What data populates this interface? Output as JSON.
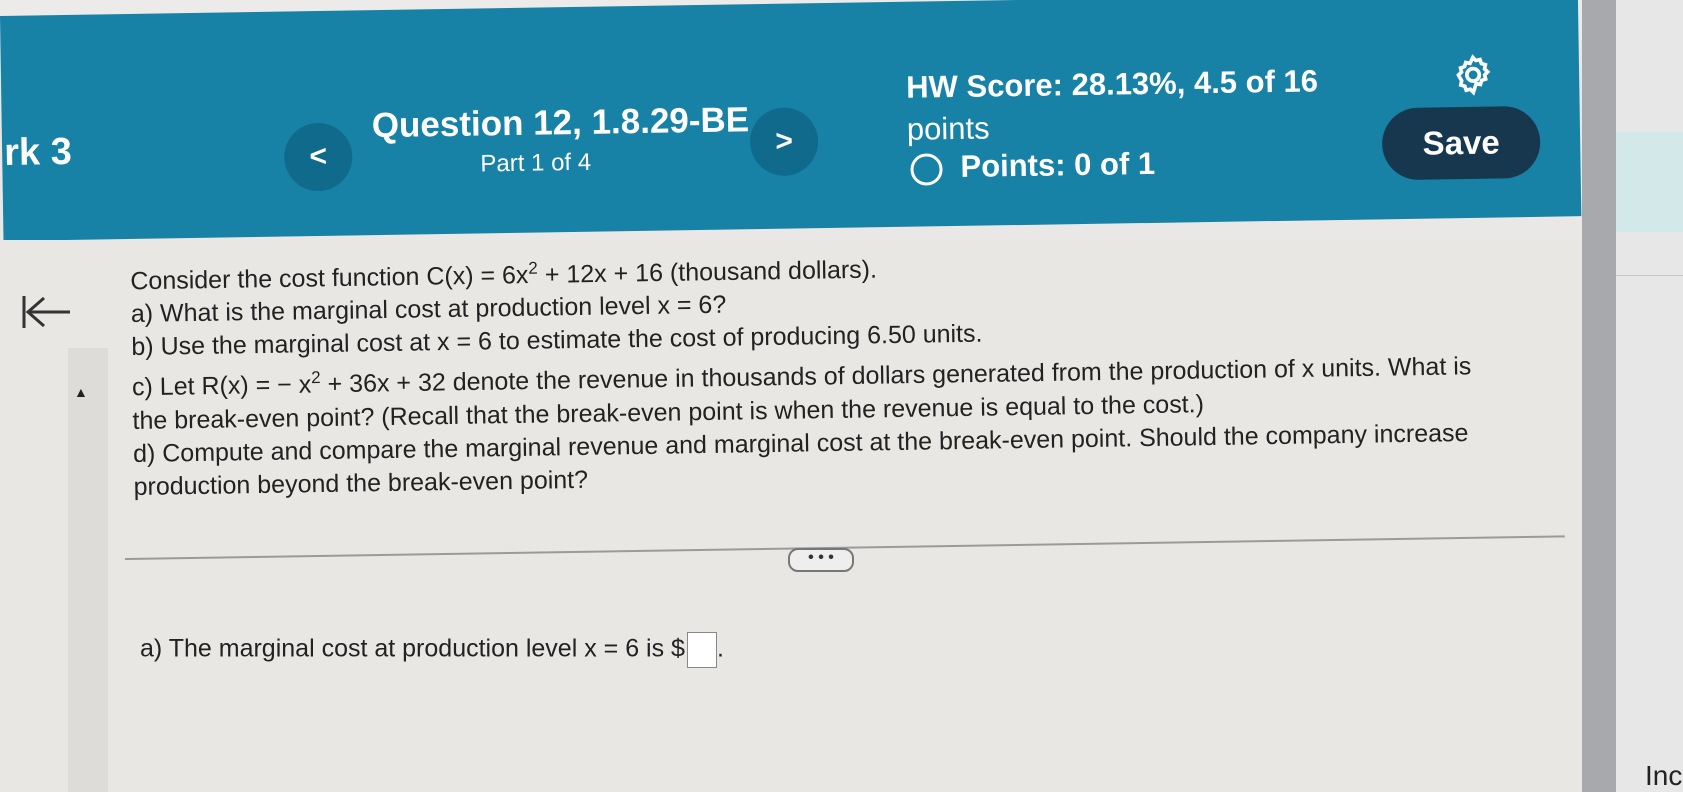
{
  "header": {
    "course_label": "rk 3",
    "prev_glyph": "<",
    "next_glyph": ">",
    "question_title": "Question 12, 1.8.29-BE",
    "question_part": "Part 1 of 4",
    "hw_score_line1": "HW Score: 28.13%, 4.5 of 16",
    "hw_score_line2": "points",
    "points_label": "Points: 0 of 1",
    "save_label": "Save",
    "settings_icon": "gear-icon"
  },
  "problem": {
    "intro_prefix": "Consider the cost function C(x) = 6x",
    "intro_exp": "2",
    "intro_suffix": " + 12x + 16 (thousand dollars).",
    "part_a": "a) What is the marginal cost at production level x = 6?",
    "part_b": "b) Use the marginal cost at x = 6 to estimate the cost of producing 6.50 units.",
    "part_c_prefix": "c) Let R(x) = − x",
    "part_c_exp": "2",
    "part_c_suffix": " + 36x + 32 denote the revenue in thousands of dollars generated from the production of x units. What is",
    "part_c_line2": "the break-even point? (Recall that the break-even point is when the revenue is equal to the cost.)",
    "part_d_line1": "d) Compute and compare the marginal revenue and marginal cost at the break-even point. Should the company increase",
    "part_d_line2": "production beyond the break-even point?"
  },
  "more_label": "• • •",
  "answer": {
    "prefix": "a) The marginal cost at production level x = 6 is $",
    "suffix": "."
  },
  "side": {
    "label": "Inc"
  },
  "colors": {
    "header_bg": "#1781a6",
    "nav_button": "#0f6a8c",
    "save_button": "#16374d"
  }
}
